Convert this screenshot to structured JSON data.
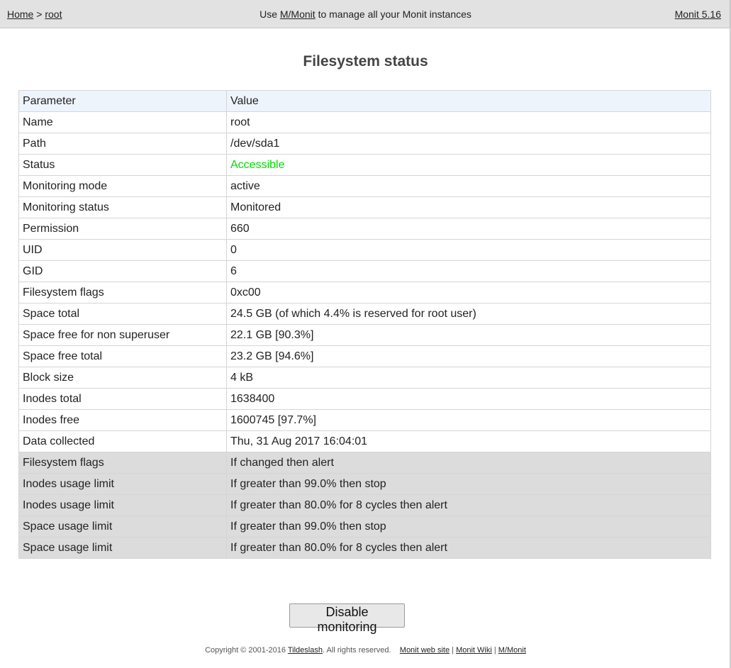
{
  "header": {
    "breadcrumb_home": "Home",
    "breadcrumb_sep": ">",
    "breadcrumb_current": "root",
    "message_prefix": "Use",
    "message_link": "M/Monit",
    "message_suffix": "to manage all your Monit instances",
    "version": "Monit 5.16"
  },
  "page_title": "Filesystem status",
  "table": {
    "headers": [
      "Parameter",
      "Value"
    ],
    "status_color": "#00dd00",
    "rows": [
      [
        "Name",
        "root"
      ],
      [
        "Path",
        "/dev/sda1"
      ],
      [
        "Status",
        "Accessible"
      ],
      [
        "Monitoring mode",
        "active"
      ],
      [
        "Monitoring status",
        "Monitored"
      ],
      [
        "Permission",
        "660"
      ],
      [
        "UID",
        "0"
      ],
      [
        "GID",
        "6"
      ],
      [
        "Filesystem flags",
        "0xc00"
      ],
      [
        "Space total",
        "24.5 GB (of which 4.4% is reserved for root user)"
      ],
      [
        "Space free for non superuser",
        "22.1 GB [90.3%]"
      ],
      [
        "Space free total",
        "23.2 GB [94.6%]"
      ],
      [
        "Block size",
        "4 kB"
      ],
      [
        "Inodes total",
        "1638400"
      ],
      [
        "Inodes free",
        "1600745 [97.7%]"
      ],
      [
        "Data collected",
        "Thu, 31 Aug 2017 16:04:01"
      ]
    ],
    "rules": [
      [
        "Filesystem flags",
        "If changed then alert"
      ],
      [
        "Inodes usage limit",
        "If greater than 99.0% then stop"
      ],
      [
        "Inodes usage limit",
        "If greater than 80.0% for 8 cycles then alert"
      ],
      [
        "Space usage limit",
        "If greater than 99.0% then stop"
      ],
      [
        "Space usage limit",
        "If greater than 80.0% for 8 cycles then alert"
      ]
    ]
  },
  "disable_button_label": "Disable monitoring",
  "footer": {
    "copyright": "Copyright © 2001-2016",
    "company": "Tildeslash",
    "rights": ". All rights reserved.",
    "link_website": "Monit web site",
    "link_wiki": "Monit Wiki",
    "link_mmonit": "M/Monit",
    "separator": "|"
  }
}
